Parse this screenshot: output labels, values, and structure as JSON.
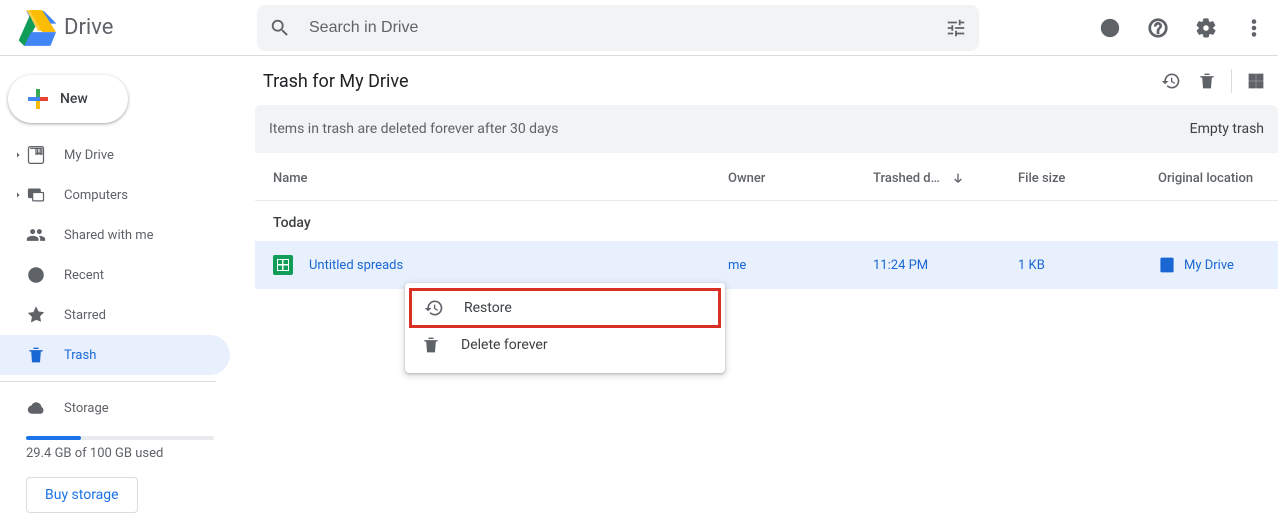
{
  "app": {
    "name": "Drive"
  },
  "search": {
    "placeholder": "Search in Drive"
  },
  "sidebar": {
    "new_label": "New",
    "items": [
      {
        "label": "My Drive"
      },
      {
        "label": "Computers"
      },
      {
        "label": "Shared with me"
      },
      {
        "label": "Recent"
      },
      {
        "label": "Starred"
      },
      {
        "label": "Trash"
      },
      {
        "label": "Storage"
      }
    ],
    "storage_used_text": "29.4 GB of 100 GB used",
    "buy_storage_label": "Buy storage"
  },
  "main": {
    "title": "Trash for My Drive",
    "banner_msg": "Items in trash are deleted forever after 30 days",
    "empty_trash_label": "Empty trash",
    "columns": {
      "name": "Name",
      "owner": "Owner",
      "trashed": "Trashed d…",
      "size": "File size",
      "orig": "Original location"
    },
    "section_label": "Today",
    "rows": [
      {
        "name": "Untitled spreads",
        "owner": "me",
        "trashed": "11:24 PM",
        "size": "1 KB",
        "orig": "My Drive"
      }
    ]
  },
  "context_menu": {
    "restore": "Restore",
    "delete_forever": "Delete forever"
  }
}
